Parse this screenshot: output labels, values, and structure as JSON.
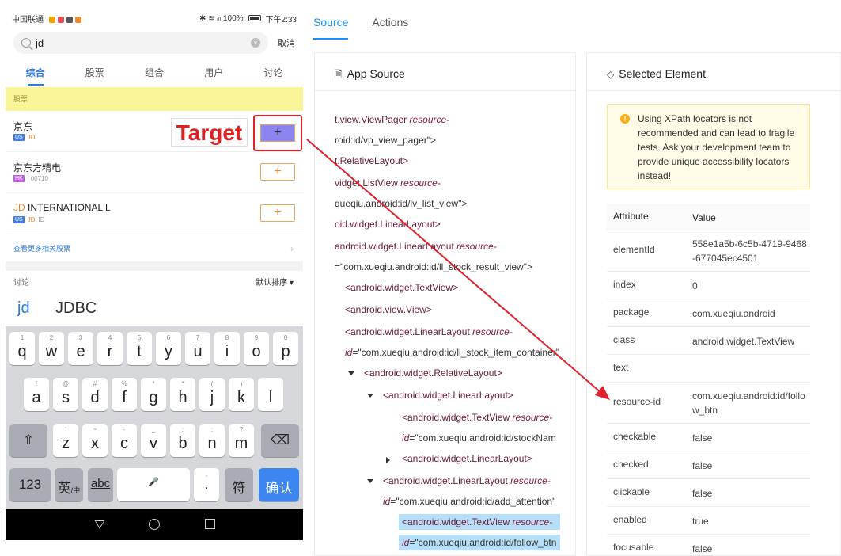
{
  "phone": {
    "status": {
      "carrier": "中国联通",
      "right_text": "✱ ≋ ᵢₗₗ 100%",
      "time": "下午2:33"
    },
    "search": {
      "query": "jd",
      "cancel": "取消"
    },
    "tabs": [
      "综合",
      "股票",
      "组合",
      "用户",
      "讨论"
    ],
    "section_header": "股票",
    "stocks": [
      {
        "name_hl": "",
        "name": "京东",
        "market": "US",
        "market_color": "#3f7fe0",
        "code_hl": "JD",
        "code": ""
      },
      {
        "name_hl": "",
        "name": "京东方精电",
        "market": "HK",
        "market_color": "#c15de0",
        "code_hl": "",
        "code": "00710"
      },
      {
        "name_hl": "JD",
        "name": " INTERNATIONAL L",
        "market": "US",
        "market_color": "#3f7fe0",
        "code_hl": "JD",
        "code": "ID"
      }
    ],
    "add_symbol": "+",
    "more_link": "查看更多相关股票",
    "more_chevron": "›",
    "target_label": "Target",
    "discuss_label": "讨论",
    "sort_label": "默认排序 ▾",
    "suggestions": [
      "jd",
      "JDBC"
    ],
    "keyboard": {
      "row1": [
        [
          "1",
          "q"
        ],
        [
          "2",
          "w"
        ],
        [
          "3",
          "e"
        ],
        [
          "4",
          "r"
        ],
        [
          "5",
          "t"
        ],
        [
          "6",
          "y"
        ],
        [
          "7",
          "u"
        ],
        [
          "8",
          "i"
        ],
        [
          "9",
          "o"
        ],
        [
          "0",
          "p"
        ]
      ],
      "row2": [
        [
          "!",
          "a"
        ],
        [
          "@",
          "s"
        ],
        [
          "#",
          "d"
        ],
        [
          "%",
          "f"
        ],
        [
          "/",
          "g"
        ],
        [
          "*",
          "h"
        ],
        [
          "(",
          "j"
        ],
        [
          ")",
          "k"
        ],
        [
          "",
          "l"
        ]
      ],
      "row3": [
        [
          "'",
          "z"
        ],
        [
          "~",
          "x"
        ],
        [
          "-",
          "c"
        ],
        [
          "_",
          "v"
        ],
        [
          ":",
          "b"
        ],
        [
          ";",
          "n"
        ],
        [
          "?",
          "m"
        ]
      ],
      "shift": "⇧",
      "backspace": "⌫",
      "num_key": "123",
      "lang_key": "英",
      "lang_sub": "/中",
      "abc_key": "abc",
      "space_mic": "🎤",
      "punct_key": "·",
      "punct_sub": ",",
      "sym_key": "符",
      "confirm_key": "确认"
    }
  },
  "right": {
    "tabs": [
      "Source",
      "Actions"
    ],
    "source_title": "App Source",
    "source_icon": "🗎",
    "selected_title": "Selected Element",
    "selected_icon": "◇",
    "tree": [
      {
        "text": "t.view.ViewPager ",
        "attr": "resource-",
        "val": ""
      },
      {
        "text": "",
        "attr": "",
        "val": "roid:id/vp_view_pager\">"
      },
      {
        "text": "t.RelativeLayout>",
        "attr": "",
        "val": ""
      },
      {
        "text": "vidget.ListView ",
        "attr": "resource-",
        "val": ""
      },
      {
        "text": "",
        "attr": "",
        "val": "queqiu.android:id/lv_list_view\">"
      },
      {
        "text": "oid.widget.LinearLayout>",
        "attr": "",
        "val": ""
      },
      {
        "text": "android.widget.LinearLayout ",
        "attr": "resource-",
        "val": ""
      },
      {
        "text": "",
        "attr": "",
        "val": "=\"com.xueqiu.android:id/ll_stock_result_view\">"
      },
      {
        "text": "<android.widget.TextView>",
        "attr": "",
        "val": ""
      },
      {
        "text": "<android.view.View>",
        "attr": "",
        "val": ""
      },
      {
        "text": "<android.widget.LinearLayout ",
        "attr": "resource-",
        "val": ""
      },
      {
        "text": "",
        "attr": "id",
        "val": "=\"com.xueqiu.android:id/ll_stock_item_container\""
      },
      {
        "text": "<android.widget.RelativeLayout>",
        "attr": "",
        "val": ""
      },
      {
        "text": "<android.widget.LinearLayout>",
        "attr": "",
        "val": ""
      },
      {
        "text": "<android.widget.TextView ",
        "attr": "resource-",
        "val": ""
      },
      {
        "text": "",
        "attr": "id",
        "val": "=\"com.xueqiu.android:id/stockNam"
      },
      {
        "text": "<android.widget.LinearLayout>",
        "attr": "",
        "val": ""
      },
      {
        "text": "<android.widget.LinearLayout ",
        "attr": "resource-",
        "val": ""
      },
      {
        "text": "",
        "attr": "id",
        "val": "=\"com.xueqiu.android:id/add_attention\""
      },
      {
        "text": "<android.widget.TextView ",
        "attr": "resource-",
        "val": ""
      },
      {
        "text": "",
        "attr": "id",
        "val": "=\"com.xueqiu.android:id/follow_btn"
      }
    ],
    "warning": "Using XPath locators is not recommended and can lead to fragile tests. Ask your development team to provide unique accessibility locators instead!",
    "warning_icon": "!",
    "attr_header": [
      "Attribute",
      "Value"
    ],
    "attributes": [
      [
        "elementId",
        "558e1a5b-6c5b-4719-9468-677045ec4501"
      ],
      [
        "index",
        "0"
      ],
      [
        "package",
        "com.xueqiu.android"
      ],
      [
        "class",
        "android.widget.TextView"
      ],
      [
        "text",
        ""
      ],
      [
        "resource-id",
        "com.xueqiu.android:id/follow_btn"
      ],
      [
        "checkable",
        "false"
      ],
      [
        "checked",
        "false"
      ],
      [
        "clickable",
        "false"
      ],
      [
        "enabled",
        "true"
      ],
      [
        "focusable",
        "false"
      ]
    ]
  },
  "colors": {
    "accent": "#1890ff",
    "target_red": "#e0202a",
    "highlight": "#b6dff8"
  }
}
